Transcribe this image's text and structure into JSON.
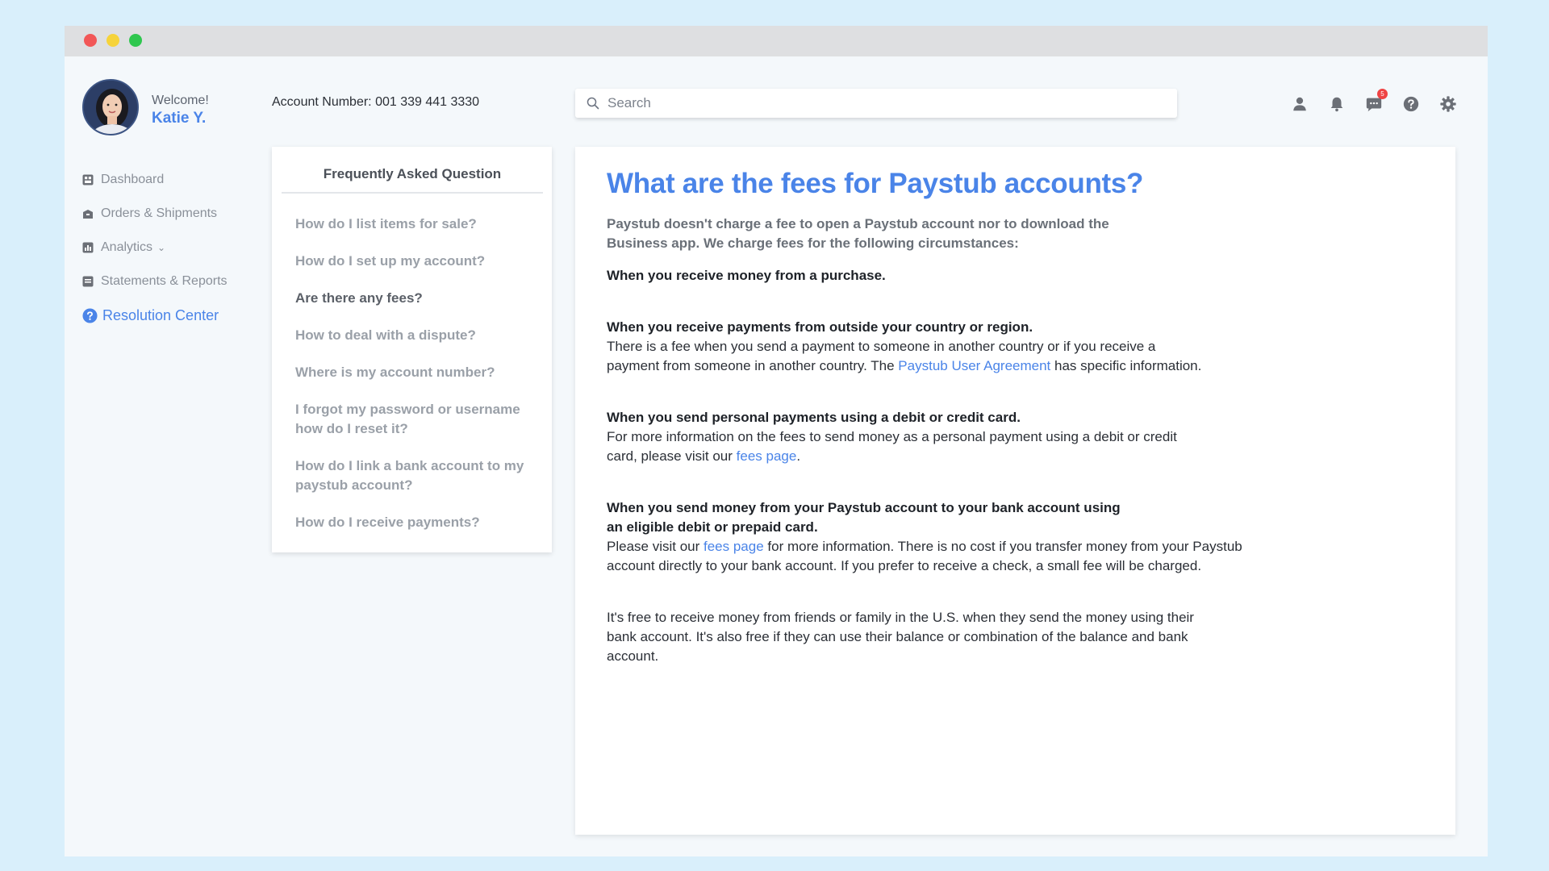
{
  "user": {
    "welcome": "Welcome!",
    "name": "Katie Y."
  },
  "account": {
    "label": "Account Number:",
    "number": "001 339 441 3330"
  },
  "search": {
    "placeholder": "Search"
  },
  "notifications": {
    "message_count": "5"
  },
  "sidebar": {
    "items": [
      {
        "label": "Dashboard",
        "icon": "dashboard-icon"
      },
      {
        "label": "Orders & Shipments",
        "icon": "box-icon"
      },
      {
        "label": "Analytics",
        "icon": "analytics-icon"
      },
      {
        "label": "Statements & Reports",
        "icon": "statements-icon"
      },
      {
        "label": "Resolution Center",
        "icon": "help-circle-icon"
      }
    ]
  },
  "faq": {
    "title": "Frequently Asked Question",
    "items": [
      "How do I list items for sale?",
      "How do I set up my account?",
      "Are there any fees?",
      "How to deal with a dispute?",
      "Where is my account number?",
      "I forgot my password or username how do I reset it?",
      "How do I link a bank account to my paystub account?",
      "How do I receive payments?"
    ]
  },
  "article": {
    "title": "What are the fees for Paystub accounts?",
    "intro": "Paystub doesn't charge a fee to open a Paystub account nor to download the Business app. We charge fees for the following circumstances:",
    "sections": [
      {
        "head": "When you receive money from a purchase."
      },
      {
        "head": "When you receive payments from outside your country or region.",
        "text_before": "There is a fee when you send a payment to someone in another country or if you receive a payment from someone in another country. The ",
        "link": "Paystub User Agreement",
        "text_after": " has specific information."
      },
      {
        "head": "When you send personal payments using a debit or credit card.",
        "text_before": "For more information on the fees to send money as a personal payment using a debit or credit card, please visit our ",
        "link": "fees page",
        "text_after": "."
      },
      {
        "head": "When you send money from your Paystub account to your bank account using an eligible debit or prepaid card.",
        "text_before": "Please visit our ",
        "link": "fees page",
        "text_after": " for more information. There is no cost if you transfer money from your Paystub account directly to your bank account. If you prefer to receive a check, a small fee will be charged."
      },
      {
        "text_before": "It's free to receive money from friends or family in the U.S. when they send the money using their bank account. It's also free if they can use their balance or combination of the balance and bank account."
      }
    ]
  },
  "colors": {
    "accent": "#4a84e8",
    "background": "#d9effb",
    "window": "#f4f8fb"
  }
}
